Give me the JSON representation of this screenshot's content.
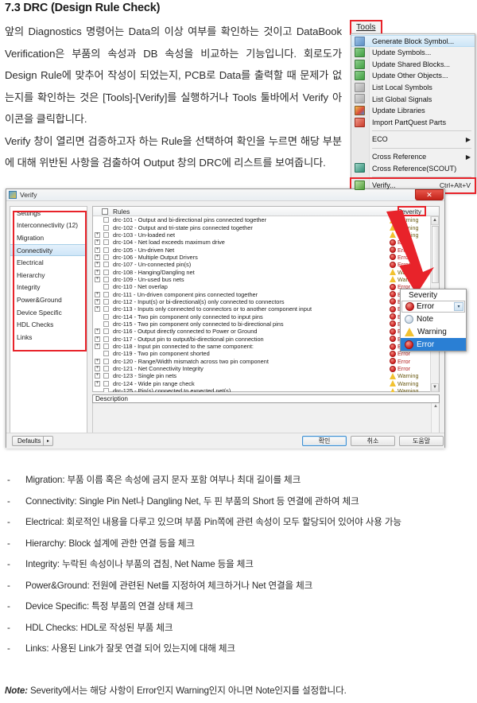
{
  "document": {
    "heading": "7.3 DRC (Design Rule Check)",
    "paragraph": "앞의 Diagnostics 명령어는 Data의 이상 여부를 확인하는 것이고 DataBook Verification은 부품의 속성과 DB 속성을 비교하는 기능입니다. 회로도가 Design Rule에 맞추어 작성이 되었는지, PCB로 Data를 출력할 때 문제가 없는지를 확인하는 것은 [Tools]-[Verify]를 실행하거나 Tools 툴바에서 Verify 아이콘을 클릭합니다.\nVerify 창이 열리면 검증하고자 하는 Rule을 선택하여 확인을 누르면 해당 부분에 대해 위반된 사항을 검출하여 Output 창의 DRC에 리스트를 보여줍니다."
  },
  "tools_menu": {
    "button_label": "Tools",
    "items": [
      {
        "label": "Generate Block Symbol...",
        "icon": "generate-block-symbol-icon",
        "icon_class": "ic-blue",
        "highlight": true,
        "shortcut": "",
        "submenu": false
      },
      {
        "label": "Update Symbols...",
        "icon": "update-symbols-icon",
        "icon_class": "ic-green",
        "highlight": false,
        "shortcut": "",
        "submenu": false
      },
      {
        "label": "Update Shared Blocks...",
        "icon": "update-shared-blocks-icon",
        "icon_class": "ic-green",
        "highlight": false,
        "shortcut": "",
        "submenu": false
      },
      {
        "label": "Update Other Objects...",
        "icon": "update-other-objects-icon",
        "icon_class": "ic-green",
        "highlight": false,
        "shortcut": "",
        "submenu": false
      },
      {
        "label": "List Local Symbols",
        "icon": "list-local-symbols-icon",
        "icon_class": "ic-grey",
        "highlight": false,
        "shortcut": "",
        "submenu": false
      },
      {
        "label": "List Global Signals",
        "icon": "list-global-signals-icon",
        "icon_class": "ic-grey",
        "highlight": false,
        "shortcut": "",
        "submenu": false
      },
      {
        "label": "Update Libraries",
        "icon": "update-libraries-icon",
        "icon_class": "ic-multi",
        "highlight": false,
        "shortcut": "",
        "submenu": false
      },
      {
        "label": "Import PartQuest Parts",
        "icon": "import-partquest-parts-icon",
        "icon_class": "ic-red",
        "highlight": false,
        "shortcut": "",
        "submenu": false
      }
    ],
    "items2": [
      {
        "label": "ECO",
        "icon": "",
        "icon_class": "",
        "shortcut": "",
        "submenu": true
      }
    ],
    "items3": [
      {
        "label": "Cross Reference",
        "icon": "",
        "icon_class": "",
        "shortcut": "",
        "submenu": true
      },
      {
        "label": "Cross Reference(SCOUT)",
        "icon": "cross-reference-scout-icon",
        "icon_class": "ic-teal",
        "shortcut": "",
        "submenu": false
      }
    ],
    "items4": [
      {
        "label": "Verify...",
        "icon": "verify-shield-icon",
        "icon_class": "ic-shield",
        "shortcut": "Ctrl+Alt+V",
        "submenu": false
      }
    ]
  },
  "verify_dialog": {
    "title": "Verify",
    "close_label": "✕",
    "nav_items": [
      {
        "label": "Settings",
        "selected": false
      },
      {
        "label": "Interconnectivity (12)",
        "selected": false
      },
      {
        "label": "Migration",
        "selected": false
      },
      {
        "label": "Connectivity",
        "selected": true
      },
      {
        "label": "Electrical",
        "selected": false
      },
      {
        "label": "Hierarchy",
        "selected": false
      },
      {
        "label": "Integrity",
        "selected": false
      },
      {
        "label": "Power&Ground",
        "selected": false
      },
      {
        "label": "Device Specific",
        "selected": false
      },
      {
        "label": "HDL Checks",
        "selected": false
      },
      {
        "label": "Links",
        "selected": false
      }
    ],
    "rules_header": "Rules",
    "severity_header": "Severity",
    "rules": [
      {
        "label": "drc-101 - Output and bi-directional pins connected together",
        "severity": "Warning",
        "expandable": false
      },
      {
        "label": "drc-102 - Output and tri-state pins connected together",
        "severity": "Warning",
        "expandable": false
      },
      {
        "label": "drc-103 - Un-loaded net",
        "severity": "Warning",
        "expandable": true
      },
      {
        "label": "drc-104 - Net load exceeds maximum drive",
        "severity": "Error",
        "expandable": true
      },
      {
        "label": "drc-105 - Un-driven Net",
        "severity": "Error",
        "expandable": true
      },
      {
        "label": "drc-106 - Multiple Output Drivers",
        "severity": "Error",
        "expandable": true
      },
      {
        "label": "drc-107 - Un-connected pin(s)",
        "severity": "Error",
        "expandable": true
      },
      {
        "label": "drc-108 - Hanging/Dangling net",
        "severity": "Warning",
        "expandable": true
      },
      {
        "label": "drc-109 - Un-used bus nets",
        "severity": "Warning",
        "expandable": true
      },
      {
        "label": "drc-110 - Net overlap",
        "severity": "Error",
        "expandable": false
      },
      {
        "label": "drc-111 - Un-driven component pins connected together",
        "severity": "Error",
        "expandable": true
      },
      {
        "label": "drc-112 - Input(s) or bi-directional(s) only connected to connectors",
        "severity": "Error",
        "expandable": true
      },
      {
        "label": "drc-113 - Inputs only connected to connectors or to another component input",
        "severity": "Error",
        "expandable": true
      },
      {
        "label": "drc-114 - Two pin component only connected to input pins",
        "severity": "Error",
        "expandable": false
      },
      {
        "label": "drc-115 - Two pin component only connected to bi-directional pins",
        "severity": "Error",
        "expandable": false
      },
      {
        "label": "drc-116 - Output directly connected to Power or Ground",
        "severity": "Error",
        "expandable": true
      },
      {
        "label": "drc-117 - Output pin to output/bi-directional pin connection",
        "severity": "Error",
        "expandable": true
      },
      {
        "label": "drc-118 - Input pin connected to the same component:",
        "severity": "Error",
        "expandable": true
      },
      {
        "label": "drc-119 - Two pin component shorted",
        "severity": "Error",
        "expandable": false
      },
      {
        "label": "drc-120 - Range/Width mismatch across two pin component",
        "severity": "Error",
        "expandable": true
      },
      {
        "label": "drc-121 - Net Connectivity Integrity",
        "severity": "Error",
        "expandable": true
      },
      {
        "label": "drc-123 - Single pin nets",
        "severity": "Warning",
        "expandable": true
      },
      {
        "label": "drc-124 - Wide pin range check",
        "severity": "Warning",
        "expandable": true
      },
      {
        "label": "drc-125 - Pin(s) connected to expected net(s)",
        "severity": "Warning",
        "expandable": false
      }
    ],
    "description_label": "Description",
    "buttons": {
      "defaults": "Defaults",
      "defaults_caret": "▸",
      "ok": "확인",
      "cancel": "취소",
      "help": "도움말"
    }
  },
  "severity_popup": {
    "title": "Severity",
    "current_value": "Error",
    "dropdown_arrow": "▾",
    "options": [
      {
        "label": "Note",
        "icon": "note-icon",
        "selected": false
      },
      {
        "label": "Warning",
        "icon": "warning-icon",
        "selected": false
      },
      {
        "label": "Error",
        "icon": "error-icon",
        "selected": true
      }
    ]
  },
  "bullets": [
    {
      "dash": "-",
      "text": "Migration: 부품 이름 혹은 속성에 금지 문자 포함 여부나 최대 길이를 체크"
    },
    {
      "dash": "-",
      "text": "Connectivity: Single Pin Net나 Dangling Net, 두 핀 부품의 Short 등 연결에 관하여 체크"
    },
    {
      "dash": "-",
      "text": "Electrical: 회로적인 내용을 다루고 있으며 부품 Pin쪽에 관련 속성이 모두 할당되어 있어야 사용 가능"
    },
    {
      "dash": "-",
      "text": "Hierarchy: Block 설계에 관한 연결 등을 체크"
    },
    {
      "dash": "-",
      "text": "Integrity: 누락된 속성이나 부품의 겹침, Net Name 등을 체크"
    },
    {
      "dash": "-",
      "text": "Power&Ground: 전원에 관련된 Net를 지정하여 체크하거나 Net 연결을 체크"
    },
    {
      "dash": "-",
      "text": "Device Specific: 특정 부품의 연결 상태 체크"
    },
    {
      "dash": "-",
      "text": "HDL Checks: HDL로 작성된 부품 체크"
    },
    {
      "dash": "-",
      "text": "Links: 사용된 Link가 잘못 연결 되어 있는지에 대해 체크"
    }
  ],
  "note": {
    "label": "Note:",
    "text": " Severity에서는 해당 사항이 Error인지 Warning인지 아니면 Note인지를 설정합니다."
  },
  "colors": {
    "highlight_red": "#e8232a",
    "error_red": "#cc1f1f",
    "warning_yellow": "#f2c230",
    "selection_blue": "#2a7fd4"
  }
}
